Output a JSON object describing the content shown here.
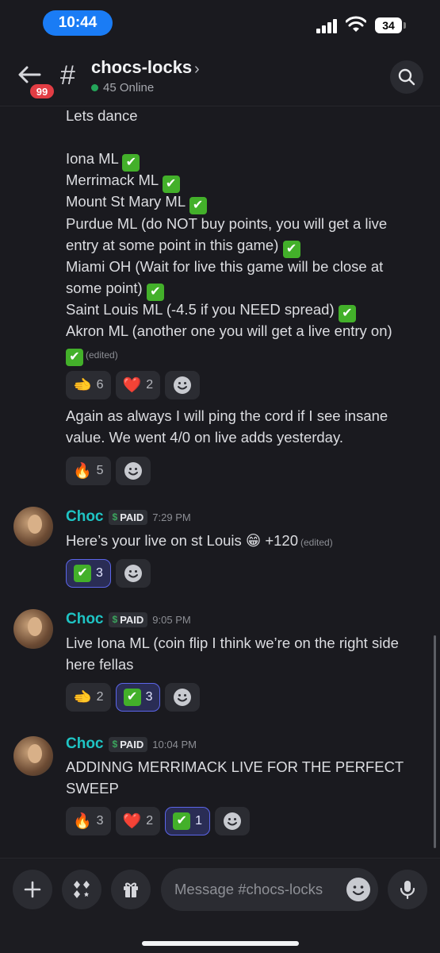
{
  "status": {
    "time": "10:44",
    "battery": "34"
  },
  "header": {
    "badge": "99",
    "channel": "chocs-locks",
    "chevron": "›",
    "online": "45 Online"
  },
  "msg1": {
    "lines": [
      "Lets dance",
      "Iona ML",
      "Merrimack ML",
      "Mount St Mary ML",
      "Purdue ML (do NOT buy points, you will get a live",
      "entry at some point in this game)",
      "Miami OH (Wait for live this game will be close at",
      "some point)",
      "Saint Louis ML (-4.5 if you NEED  spread)",
      "Akron ML (another one you will get a live entry on)"
    ],
    "edited": "(edited)",
    "reactions": [
      {
        "emoji": "🫲",
        "count": "6"
      },
      {
        "emoji": "❤️",
        "count": "2"
      }
    ]
  },
  "msg2": {
    "lines": [
      "Again as always I will ping the cord if I see insane",
      "value. We went 4/0 on live adds yesterday."
    ],
    "reactions": [
      {
        "emoji": "🔥",
        "count": "5"
      }
    ]
  },
  "msg3": {
    "author": "Choc",
    "tag": "PAID",
    "time": "7:29 PM",
    "text": "Here’s your live on st Louis",
    "emoji": "😁",
    "after": "+120",
    "edited": "(edited)",
    "reactions": [
      {
        "emoji": "✔",
        "count": "3"
      }
    ]
  },
  "msg4": {
    "author": "Choc",
    "tag": "PAID",
    "time": "9:05 PM",
    "lines": [
      "Live Iona ML (coin flip I think we’re on the right side",
      "here fellas"
    ],
    "reactions": [
      {
        "emoji": "🫲",
        "count": "2"
      },
      {
        "emoji": "✔",
        "count": "3"
      }
    ]
  },
  "msg5": {
    "author": "Choc",
    "tag": "PAID",
    "time": "10:04 PM",
    "lines": [
      "ADDINNG MERRIMACK LIVE FOR THE PERFECT",
      "SWEEP"
    ],
    "reactions": [
      {
        "emoji": "🔥",
        "count": "3"
      },
      {
        "emoji": "❤️",
        "count": "2"
      },
      {
        "emoji": "✔",
        "count": "1"
      }
    ]
  },
  "composer": {
    "placeholder": "Message #chocs-locks"
  },
  "icons": {
    "back": "arrow-left-icon",
    "hash": "hash-icon",
    "search": "search-icon",
    "add": "plus-icon",
    "apps": "apps-icon",
    "gift": "gift-icon",
    "emoji": "emoji-icon",
    "mic": "microphone-icon"
  }
}
